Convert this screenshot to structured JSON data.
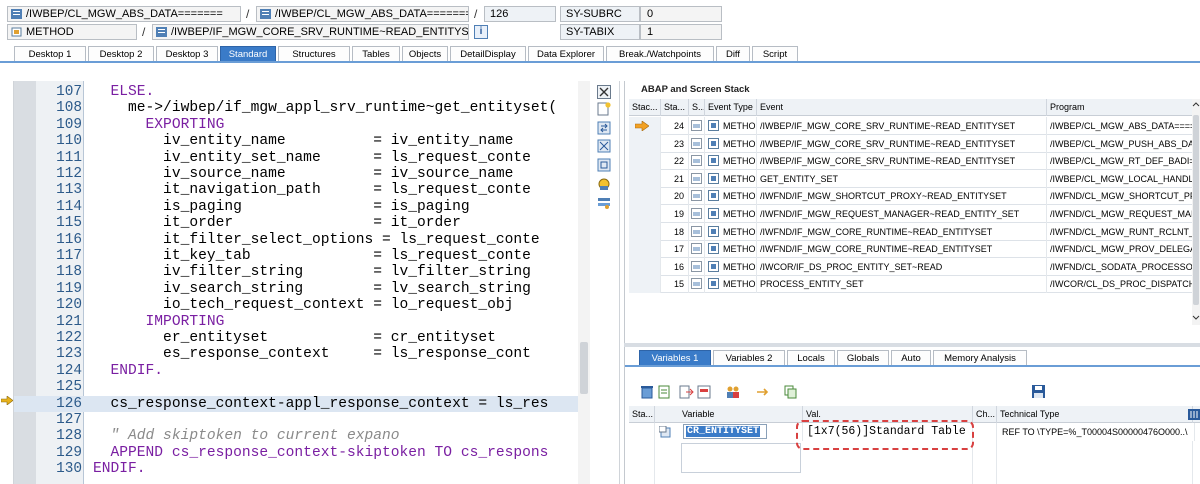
{
  "topbar": {
    "program_field": "/IWBEP/CL_MGW_ABS_DATA=======",
    "sep1": "/",
    "include_field": "/IWBEP/CL_MGW_ABS_DATA=======",
    "sep2": "/",
    "line_number": "126",
    "subrc_label": "SY-SUBRC",
    "subrc_value": "0",
    "event_type_field": "METHOD",
    "sep3": "/",
    "event_field": "/IWBEP/IF_MGW_CORE_SRV_RUNTIME~READ_ENTITYSET (/IWBEP/CL...",
    "info_icon": "i",
    "tabix_label": "SY-TABIX",
    "tabix_value": "1"
  },
  "tabs": [
    {
      "label": "Desktop 1"
    },
    {
      "label": "Desktop 2"
    },
    {
      "label": "Desktop 3"
    },
    {
      "label": "Standard"
    },
    {
      "label": "Structures"
    },
    {
      "label": "Tables"
    },
    {
      "label": "Objects"
    },
    {
      "label": "DetailDisplay"
    },
    {
      "label": "Data Explorer"
    },
    {
      "label": "Break./Watchpoints"
    },
    {
      "label": "Diff"
    },
    {
      "label": "Script"
    }
  ],
  "active_tab": "Standard",
  "code": {
    "lines": [
      {
        "num": "107",
        "text": "  ELSE."
      },
      {
        "num": "108",
        "text": "    me->/iwbep/if_mgw_appl_srv_runtime~get_entityset("
      },
      {
        "num": "109",
        "text": "      EXPORTING"
      },
      {
        "num": "110",
        "text": "        iv_entity_name          = iv_entity_name"
      },
      {
        "num": "111",
        "text": "        iv_entity_set_name      = ls_request_conte"
      },
      {
        "num": "112",
        "text": "        iv_source_name          = iv_source_name"
      },
      {
        "num": "113",
        "text": "        it_navigation_path      = ls_request_conte"
      },
      {
        "num": "114",
        "text": "        is_paging               = is_paging"
      },
      {
        "num": "115",
        "text": "        it_order                = it_order"
      },
      {
        "num": "116",
        "text": "        it_filter_select_options = ls_request_conte"
      },
      {
        "num": "117",
        "text": "        it_key_tab              = ls_request_conte"
      },
      {
        "num": "118",
        "text": "        iv_filter_string        = lv_filter_string"
      },
      {
        "num": "119",
        "text": "        iv_search_string        = lv_search_string"
      },
      {
        "num": "120",
        "text": "        io_tech_request_context = lo_request_obj"
      },
      {
        "num": "121",
        "text": "      IMPORTING"
      },
      {
        "num": "122",
        "text": "        er_entityset            = cr_entityset"
      },
      {
        "num": "123",
        "text": "        es_response_context     = ls_response_cont"
      },
      {
        "num": "124",
        "text": "  ENDIF."
      },
      {
        "num": "125",
        "text": ""
      },
      {
        "num": "126",
        "text": "  cs_response_context-appl_response_context = ls_res"
      },
      {
        "num": "127",
        "text": ""
      },
      {
        "num": "128",
        "text": "  \" Add skiptoken to current expano"
      },
      {
        "num": "129",
        "text": "  APPEND cs_response_context-skiptoken TO cs_respons"
      },
      {
        "num": "130",
        "text": "ENDIF."
      }
    ],
    "current_line": "126"
  },
  "stack": {
    "title": "ABAP and Screen Stack",
    "columns": [
      "Stac...",
      "Sta...",
      "S...",
      "Event Type",
      "Event",
      "Program"
    ],
    "rows": [
      {
        "sel": true,
        "level": "24",
        "type": "METHOD",
        "event": "/IWBEP/IF_MGW_CORE_SRV_RUNTIME~READ_ENTITYSET",
        "program": "/IWBEP/CL_MGW_ABS_DATA====="
      },
      {
        "sel": false,
        "level": "23",
        "type": "METHOD",
        "event": "/IWBEP/IF_MGW_CORE_SRV_RUNTIME~READ_ENTITYSET",
        "program": "/IWBEP/CL_MGW_PUSH_ABS_DA"
      },
      {
        "sel": false,
        "level": "22",
        "type": "METHOD",
        "event": "/IWBEP/IF_MGW_CORE_SRV_RUNTIME~READ_ENTITYSET",
        "program": "/IWBEP/CL_MGW_RT_DEF_BADI="
      },
      {
        "sel": false,
        "level": "21",
        "type": "METHOD",
        "event": "GET_ENTITY_SET",
        "program": "/IWBEP/CL_MGW_LOCAL_HANDLI"
      },
      {
        "sel": false,
        "level": "20",
        "type": "METHOD",
        "event": "/IWFND/IF_MGW_SHORTCUT_PROXY~READ_ENTITYSET",
        "program": "/IWFND/CL_MGW_SHORTCUT_PF"
      },
      {
        "sel": false,
        "level": "19",
        "type": "METHOD",
        "event": "/IWFND/IF_MGW_REQUEST_MANAGER~READ_ENTITY_SET",
        "program": "/IWFND/CL_MGW_REQUEST_MAI"
      },
      {
        "sel": false,
        "level": "18",
        "type": "METHOD",
        "event": "/IWFND/IF_MGW_CORE_RUNTIME~READ_ENTITYSET",
        "program": "/IWFND/CL_MGW_RUNT_RCLNT_"
      },
      {
        "sel": false,
        "level": "17",
        "type": "METHOD",
        "event": "/IWFND/IF_MGW_CORE_RUNTIME~READ_ENTITYSET",
        "program": "/IWFND/CL_MGW_PROV_DELEGA"
      },
      {
        "sel": false,
        "level": "16",
        "type": "METHOD",
        "event": "/IWCOR/IF_DS_PROC_ENTITY_SET~READ",
        "program": "/IWFND/CL_SODATA_PROCESSOR"
      },
      {
        "sel": false,
        "level": "15",
        "type": "METHOD",
        "event": "PROCESS_ENTITY_SET",
        "program": "/IWCOR/CL_DS_PROC_DISPATCHE"
      }
    ]
  },
  "var_tabs": [
    {
      "label": "Variables 1"
    },
    {
      "label": "Variables 2"
    },
    {
      "label": "Locals"
    },
    {
      "label": "Globals"
    },
    {
      "label": "Auto"
    },
    {
      "label": "Memory Analysis"
    }
  ],
  "variables": {
    "columns": [
      "Sta...",
      "Variable",
      "Val.",
      "Ch...",
      "Technical Type"
    ],
    "rows": [
      {
        "variable": "CR_ENTITYSET",
        "value": "[1x7(56)]Standard Table",
        "change": "",
        "tech_type": "REF TO \\TYPE=%_T00004S00000476O000..\\"
      }
    ]
  },
  "colors": {
    "accent": "#3a7bc8",
    "keyword": "#7a1fa2",
    "highlight_row": "#dce6f2",
    "annotation": "#d84040"
  }
}
